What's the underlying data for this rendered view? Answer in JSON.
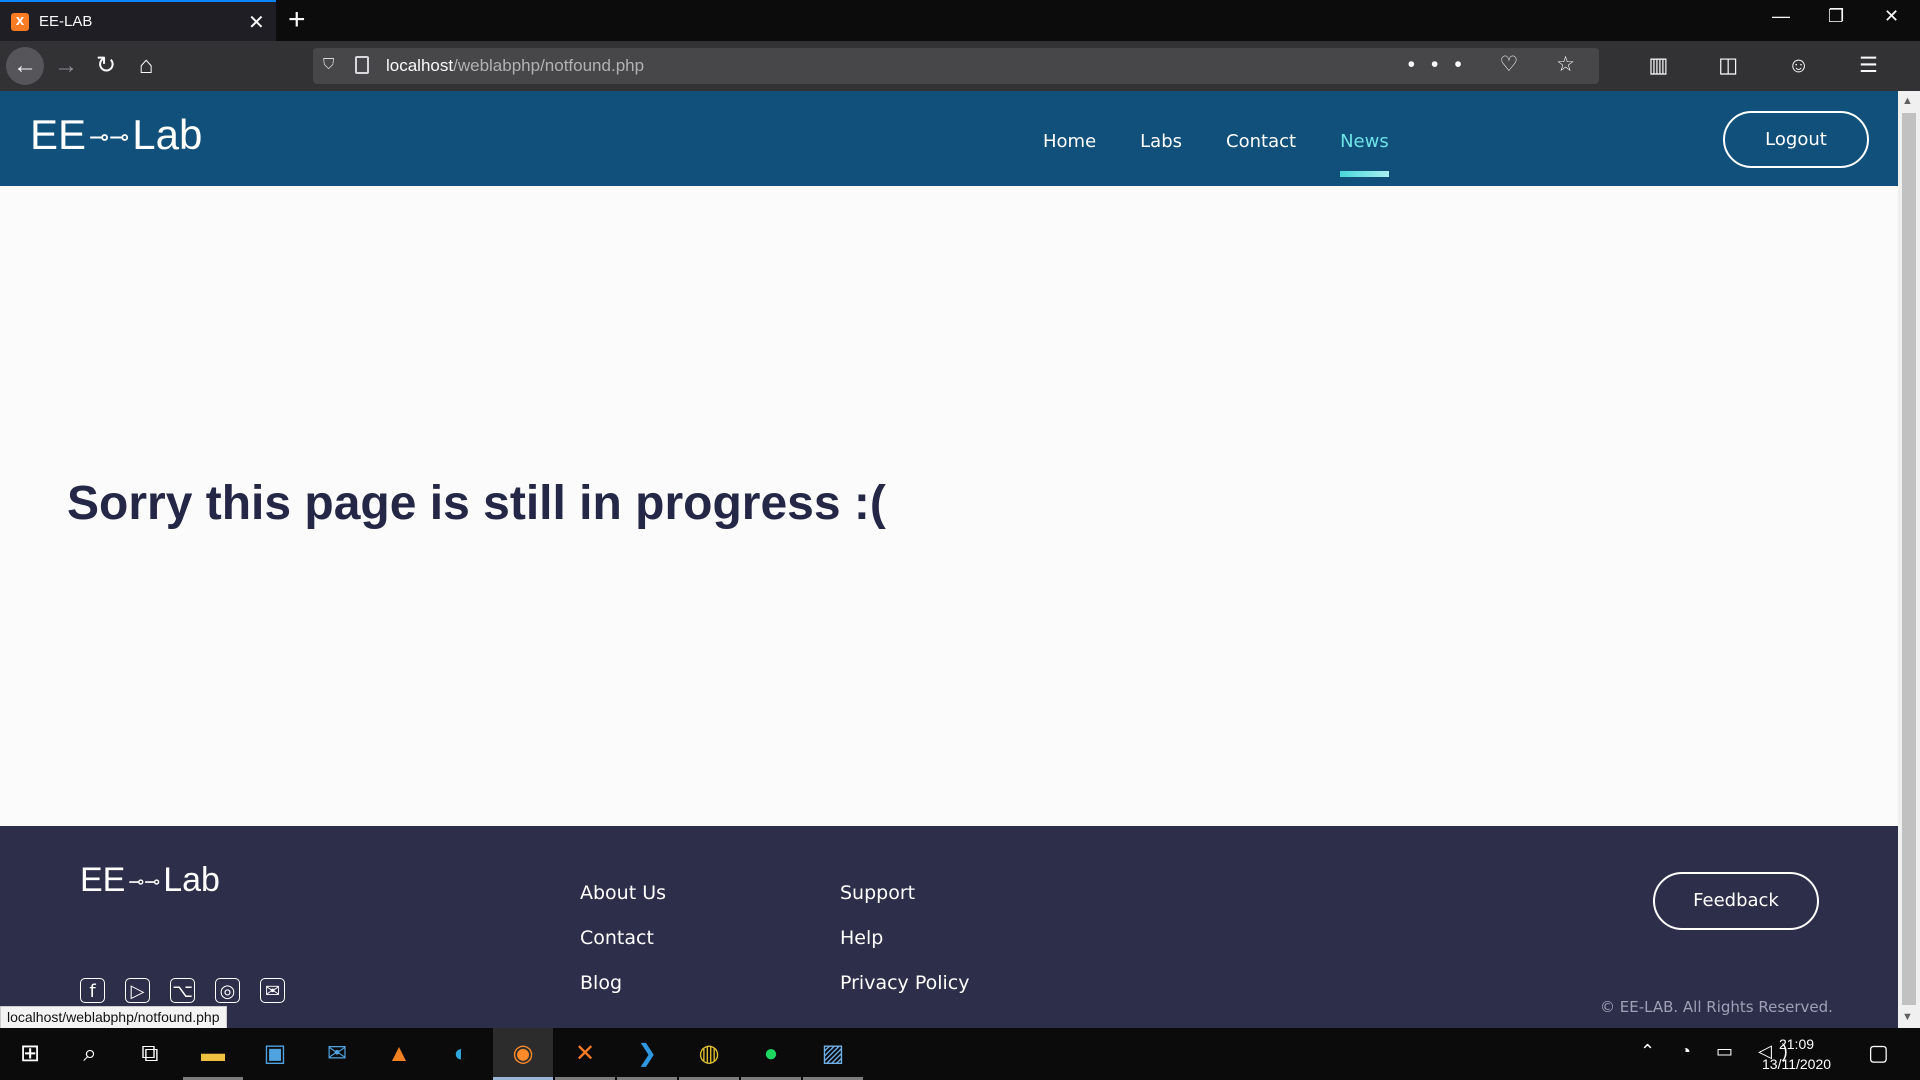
{
  "browser": {
    "tab_title": "EE-LAB",
    "tab_icon_letter": "X",
    "url_host": "localhost",
    "url_path": "/weblabphp/notfound.php",
    "status_url": "localhost/weblabphp/notfound.php",
    "url_actions": "••• ♡ ☆",
    "tool_icons": "▥ ◫ ☺ ☰"
  },
  "site": {
    "logo_left": "EE",
    "logo_mid": "⊸⊸",
    "logo_right": "Lab",
    "nav": [
      {
        "label": "Home"
      },
      {
        "label": "Labs"
      },
      {
        "label": "Contact"
      },
      {
        "label": "News",
        "active": true
      }
    ],
    "logout_label": "Logout",
    "message": "Sorry this page is still in progress :("
  },
  "footer": {
    "col1": [
      "About Us",
      "Contact",
      "Blog"
    ],
    "col2": [
      "Support",
      "Help",
      "Privacy Policy"
    ],
    "social_icons": [
      "facebook-icon",
      "youtube-icon",
      "github-icon",
      "instagram-icon",
      "mail-icon"
    ],
    "social_glyphs": [
      "f",
      "▷",
      "⌥",
      "◎",
      "✉"
    ],
    "feedback_label": "Feedback",
    "copyright": "© EE-LAB. All Rights Reserved."
  },
  "taskbar": {
    "time": "21:09",
    "date": "13/11/2020",
    "tray_glyphs": "⌃ ◔ ▭ ◁)"
  }
}
